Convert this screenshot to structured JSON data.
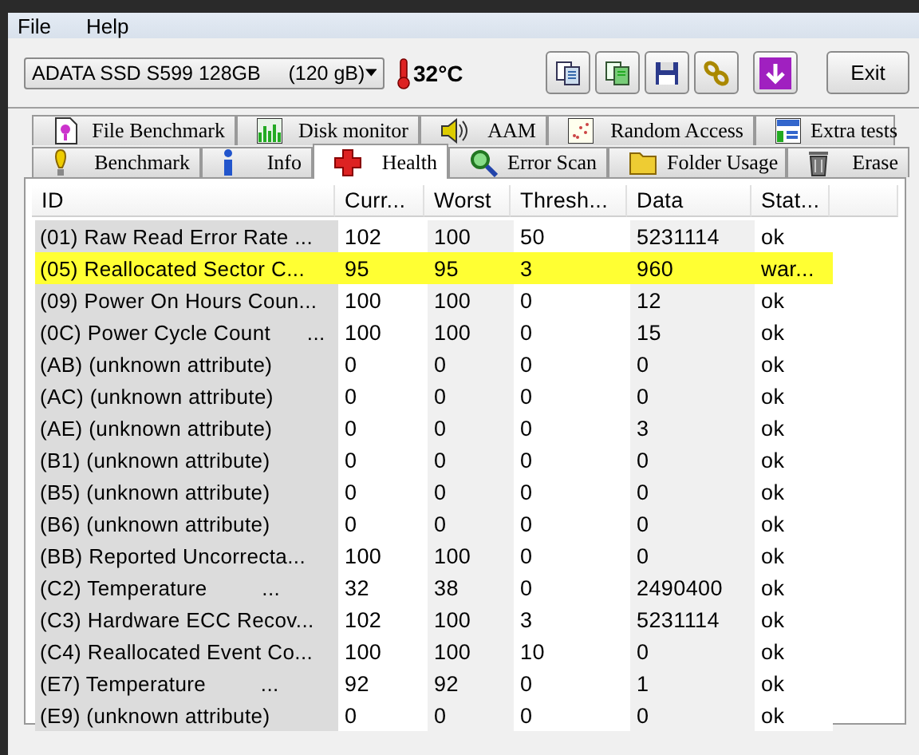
{
  "menu": [
    {
      "label": "File"
    },
    {
      "label": "Help"
    }
  ],
  "drive_select": {
    "value": "ADATA SSD S599 128GB     (120 gB)"
  },
  "temperature": "32°C",
  "exit_button": "Exit",
  "tab_rows": [
    [
      {
        "label": "File Benchmark",
        "selected": false
      },
      {
        "label": "Disk monitor",
        "selected": false
      },
      {
        "label": "AAM",
        "selected": false
      },
      {
        "label": "Random Access",
        "selected": false
      },
      {
        "label": "Extra tests",
        "selected": false
      }
    ],
    [
      {
        "label": "Benchmark",
        "selected": false
      },
      {
        "label": "Info",
        "selected": false
      },
      {
        "label": "Health",
        "selected": true
      },
      {
        "label": "Error Scan",
        "selected": false
      },
      {
        "label": "Folder Usage",
        "selected": false
      },
      {
        "label": "Erase",
        "selected": false
      }
    ]
  ],
  "table": {
    "columns": [
      "ID",
      "Curr...",
      "Worst",
      "Thresh...",
      "Data",
      "Stat..."
    ],
    "rows": [
      {
        "cells": [
          "(01) Raw Read Error Rate ...",
          "102",
          "100",
          "50",
          "5231114",
          "ok"
        ],
        "highlighted": false
      },
      {
        "cells": [
          "(05) Reallocated Sector C...",
          "95",
          "95",
          "3",
          "960",
          "war..."
        ],
        "highlighted": true
      },
      {
        "cells": [
          "(09) Power On Hours Coun...",
          "100",
          "100",
          "0",
          "12",
          "ok"
        ],
        "highlighted": false
      },
      {
        "cells": [
          "(0C) Power Cycle Count      ...",
          "100",
          "100",
          "0",
          "15",
          "ok"
        ],
        "highlighted": false
      },
      {
        "cells": [
          "(AB) (unknown attribute)",
          "0",
          "0",
          "0",
          "0",
          "ok"
        ],
        "highlighted": false
      },
      {
        "cells": [
          "(AC) (unknown attribute)",
          "0",
          "0",
          "0",
          "0",
          "ok"
        ],
        "highlighted": false
      },
      {
        "cells": [
          "(AE) (unknown attribute)",
          "0",
          "0",
          "0",
          "3",
          "ok"
        ],
        "highlighted": false
      },
      {
        "cells": [
          "(B1) (unknown attribute)",
          "0",
          "0",
          "0",
          "0",
          "ok"
        ],
        "highlighted": false
      },
      {
        "cells": [
          "(B5) (unknown attribute)",
          "0",
          "0",
          "0",
          "0",
          "ok"
        ],
        "highlighted": false
      },
      {
        "cells": [
          "(B6) (unknown attribute)",
          "0",
          "0",
          "0",
          "0",
          "ok"
        ],
        "highlighted": false
      },
      {
        "cells": [
          "(BB) Reported Uncorrecta...",
          "100",
          "100",
          "0",
          "0",
          "ok"
        ],
        "highlighted": false
      },
      {
        "cells": [
          "(C2) Temperature         ...",
          "32",
          "38",
          "0",
          "2490400",
          "ok"
        ],
        "highlighted": false
      },
      {
        "cells": [
          "(C3) Hardware ECC Recov...",
          "102",
          "100",
          "3",
          "5231114",
          "ok"
        ],
        "highlighted": false
      },
      {
        "cells": [
          "(C4) Reallocated Event Co...",
          "100",
          "100",
          "10",
          "0",
          "ok"
        ],
        "highlighted": false
      },
      {
        "cells": [
          "(E7) Temperature         ...",
          "92",
          "92",
          "0",
          "1",
          "ok"
        ],
        "highlighted": false
      },
      {
        "cells": [
          "(E9) (unknown attribute)",
          "0",
          "0",
          "0",
          "0",
          "ok"
        ],
        "highlighted": false
      }
    ]
  }
}
